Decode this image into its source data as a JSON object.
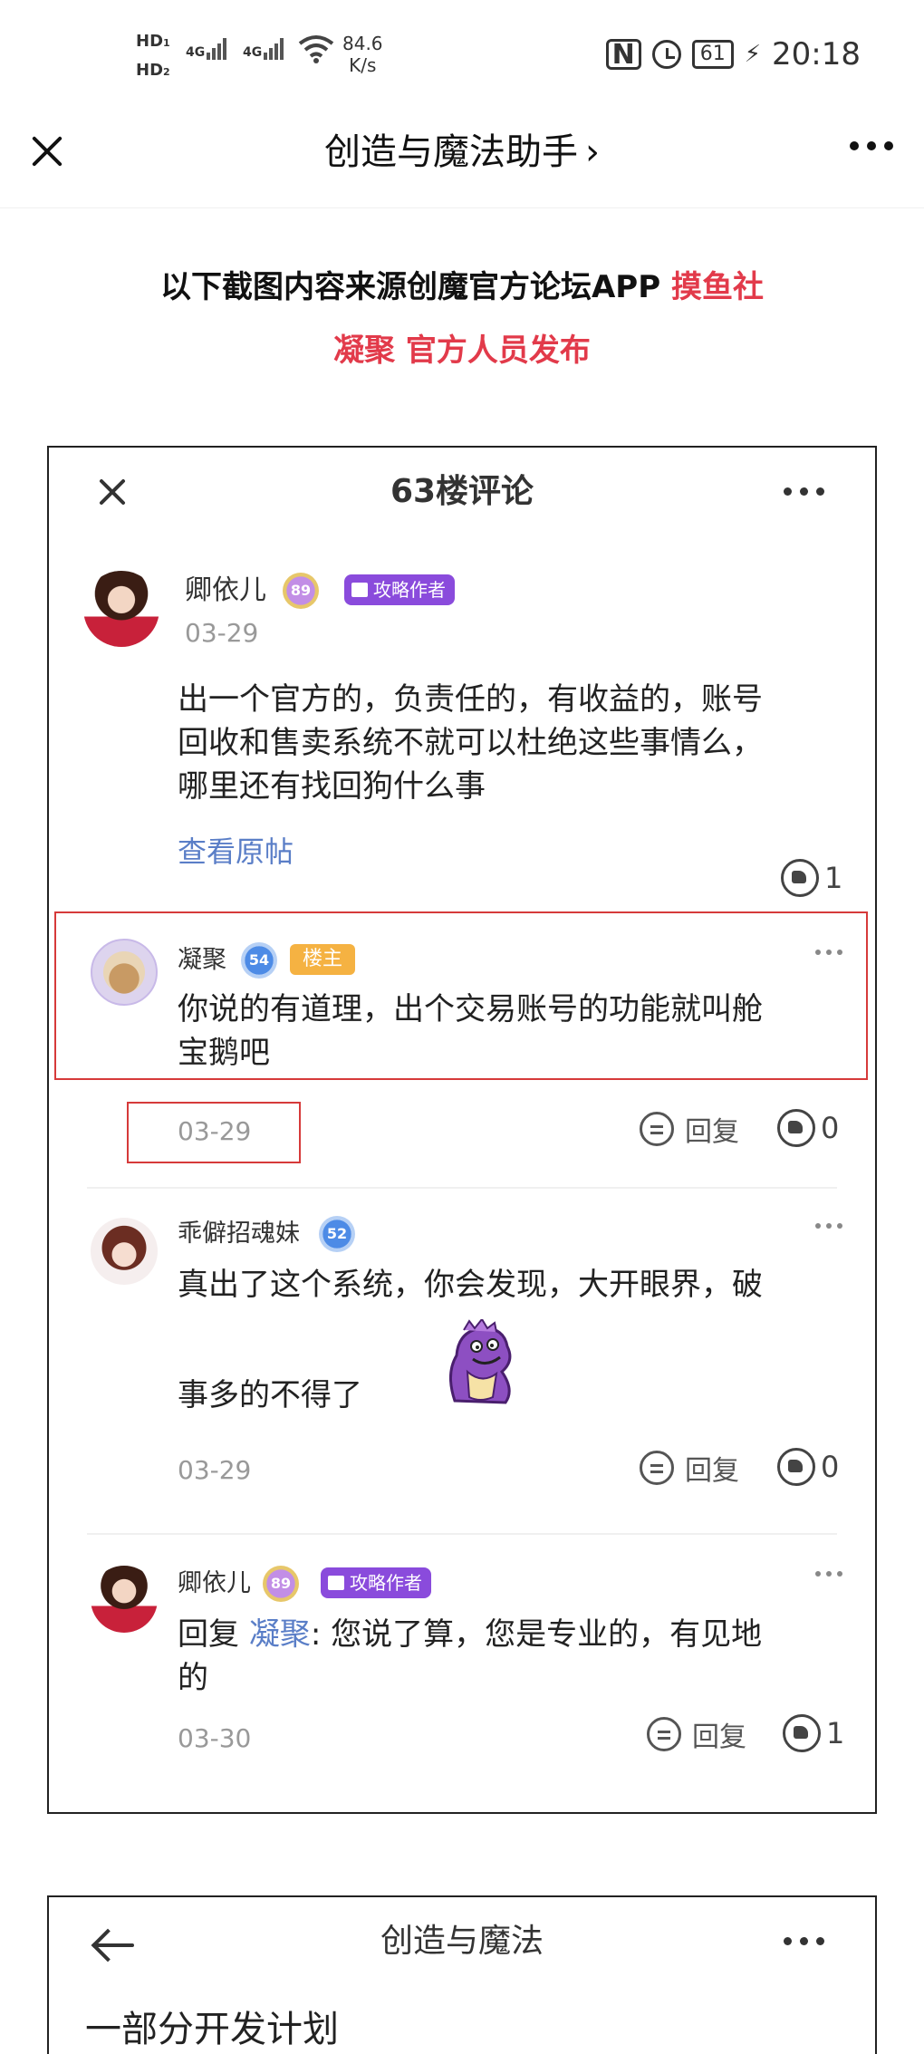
{
  "status_bar": {
    "hd1": "HD",
    "hd1_sub": "1",
    "hd2": "HD",
    "hd2_sub": "2",
    "sig1": "4G",
    "sig2": "4G",
    "speed_value": "84.6",
    "speed_unit": "K/s",
    "nfc": "N",
    "battery": "61",
    "time": "20:18"
  },
  "app_header": {
    "title": "创造与魔法助手",
    "chevron": "›"
  },
  "notice": {
    "line1_text": "以下截图内容来源创魔官方论坛APP ",
    "line1_highlight": "摸鱼社",
    "line2": "凝聚 官方人员发布"
  },
  "card1": {
    "title": "63楼评论",
    "post": {
      "username": "卿依儿",
      "level": "89",
      "badge": "攻略作者",
      "date": "03-29",
      "content": [
        "出一个官方的，负责任的，有收益的，账号",
        "回收和售卖系统不就可以杜绝这些事情么，",
        "哪里还有找回狗什么事"
      ],
      "view_original": "查看原帖",
      "likes": "1"
    },
    "comments": [
      {
        "username": "凝聚",
        "level": "54",
        "badge": "楼主",
        "content": [
          "你说的有道理，出个交易账号的功能就叫舱",
          "宝鹅吧"
        ],
        "date": "03-29",
        "reply": "回复",
        "likes": "0"
      },
      {
        "username": "乖僻招魂妹",
        "level": "52",
        "content": [
          "真出了这个系统，你会发现，大开眼界，破",
          "事多的不得了"
        ],
        "date": "03-29",
        "reply": "回复",
        "likes": "0"
      },
      {
        "username": "卿依儿",
        "level": "89",
        "badge": "攻略作者",
        "reply_prefix": "回复 ",
        "mention": "凝聚",
        "content": [
          ": 您说了算，您是专业的，有见地",
          "的"
        ],
        "date": "03-30",
        "reply": "回复",
        "likes": "1"
      }
    ]
  },
  "card2": {
    "title": "创造与魔法",
    "heading": "一部分开发计划"
  },
  "colors": {
    "highlight_red": "#e23a4a",
    "link_blue": "#5a7ec7",
    "author_badge": "#8a4bdc",
    "owner_badge": "#f5b242"
  }
}
